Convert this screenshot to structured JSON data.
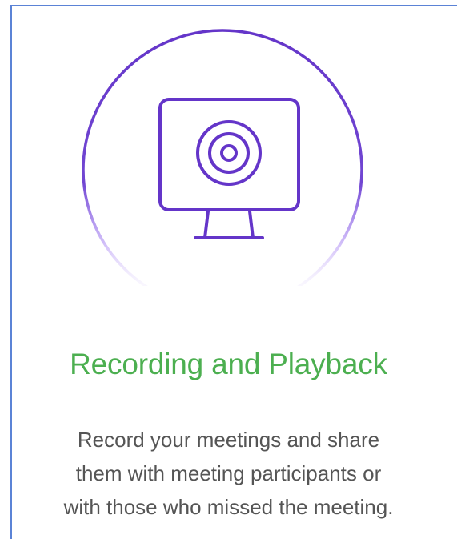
{
  "feature": {
    "icon": "monitor-record-icon",
    "title": "Recording and Playback",
    "description_lines": [
      "Record your meetings and share",
      "them with meeting participants or",
      "with those who missed the meeting."
    ]
  },
  "colors": {
    "accent_purple": "#6435c9",
    "title_green": "#4caf50",
    "text_gray": "#555555",
    "border_blue": "#5b83d6"
  }
}
